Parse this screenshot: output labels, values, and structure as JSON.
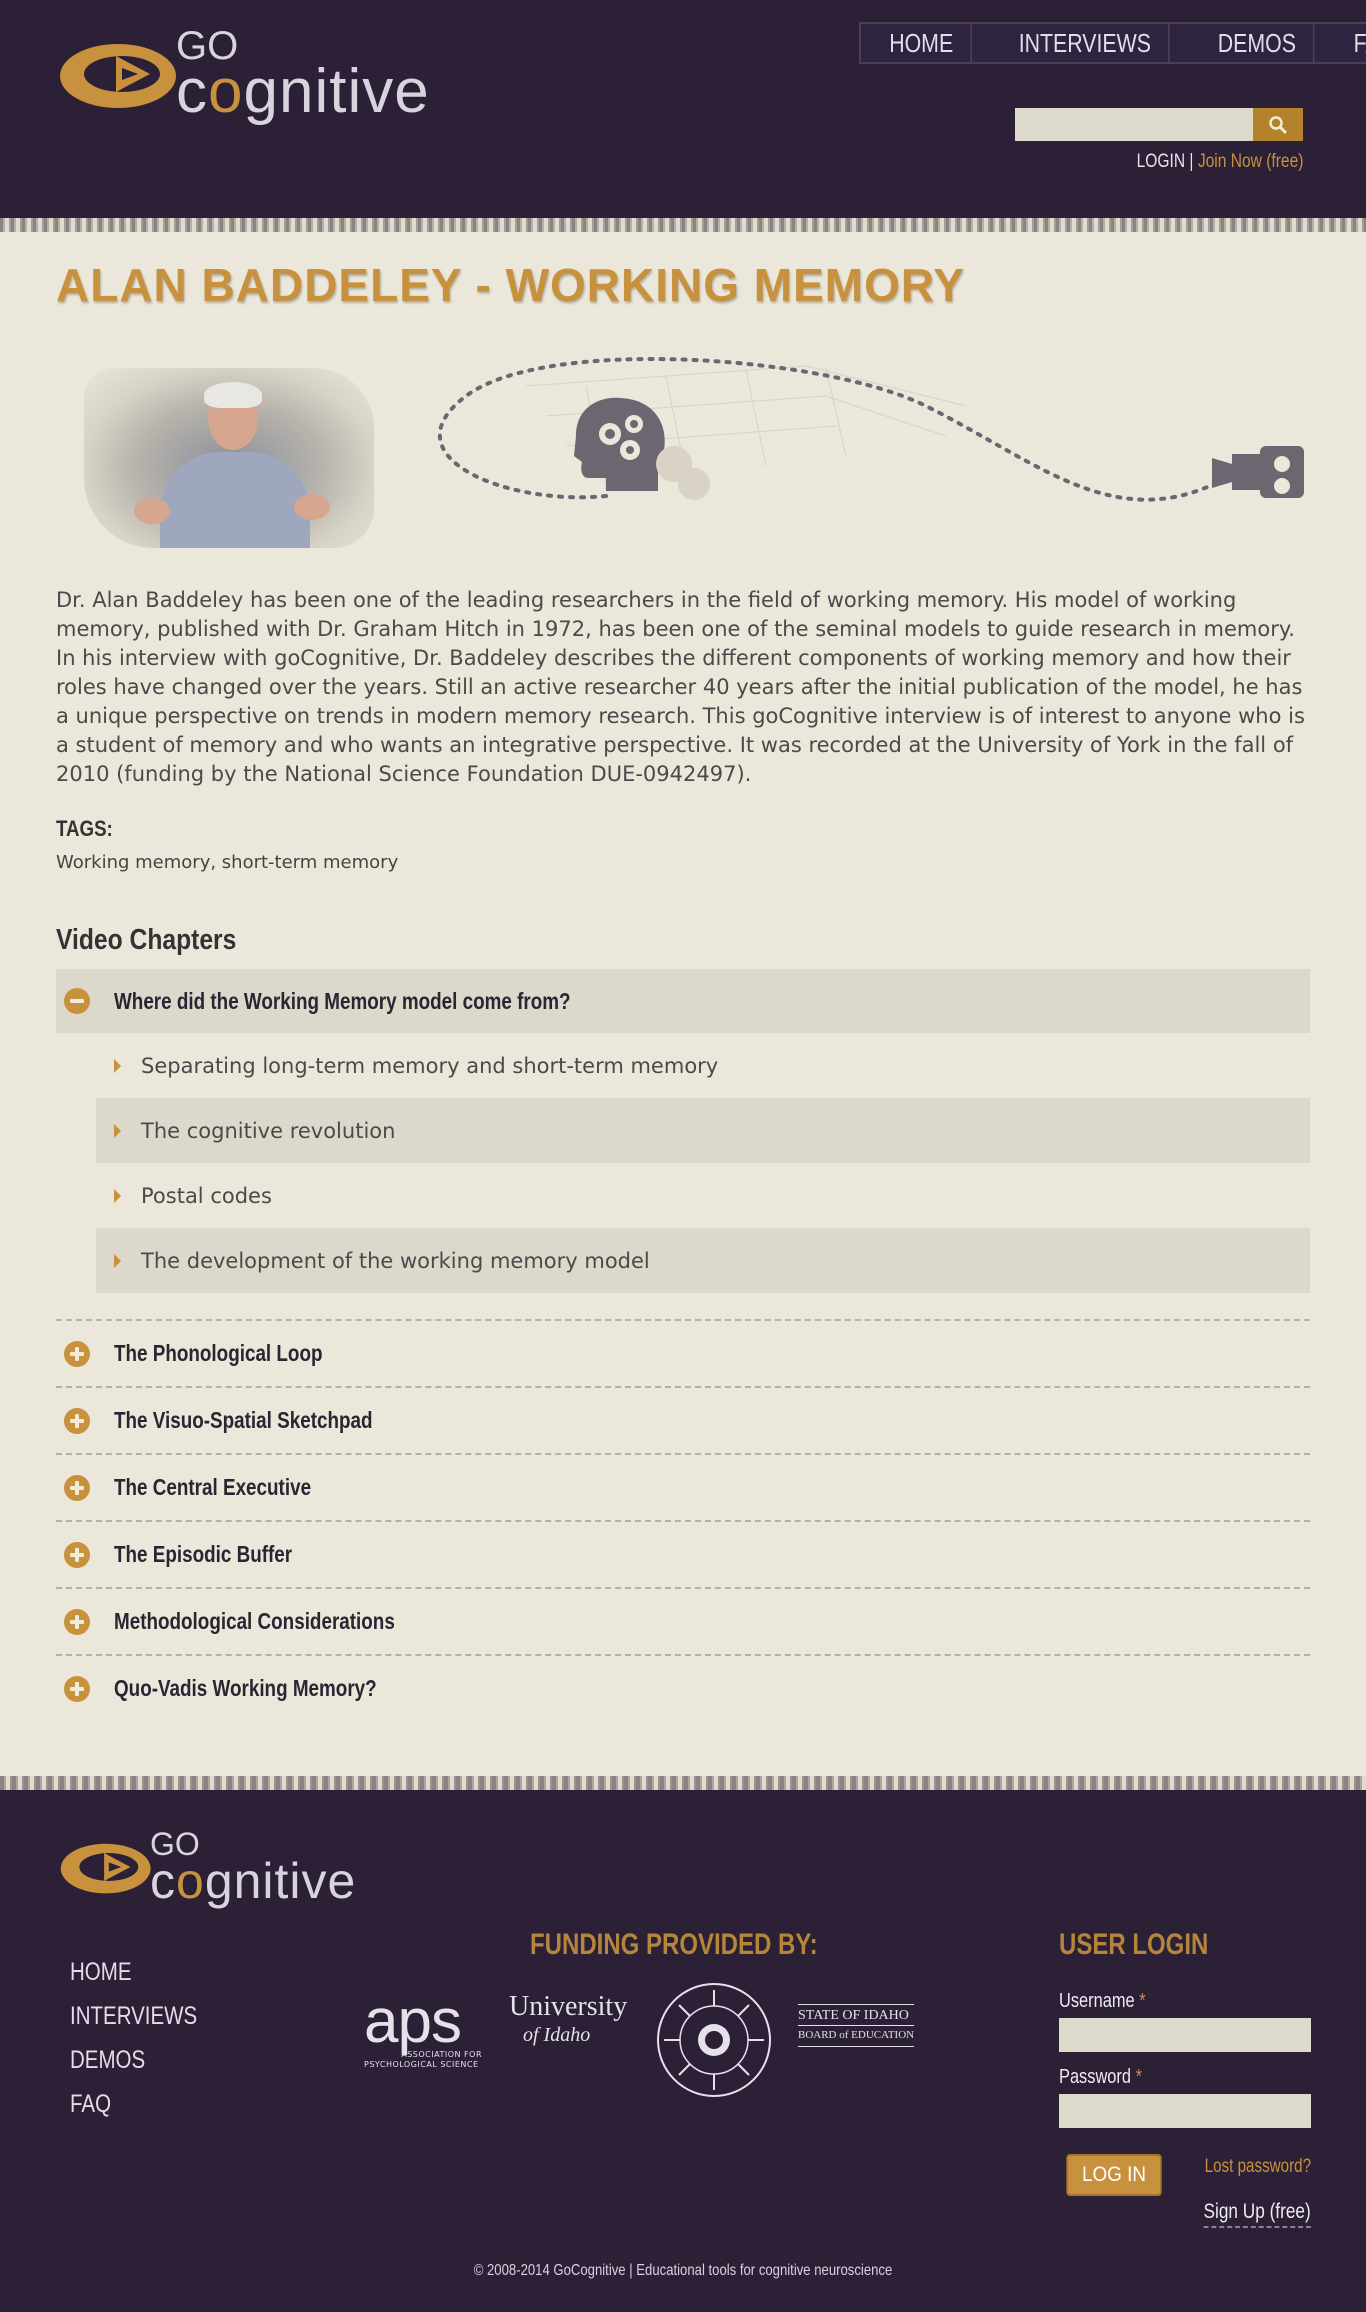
{
  "brand": {
    "logo_go": "GO",
    "logo_cog_a": "c",
    "logo_cog_o": "o",
    "logo_cog_b": "gnitive",
    "accent": "#c8913e",
    "background": "#2b2036"
  },
  "nav": {
    "items": [
      "HOME",
      "INTERVIEWS",
      "DEMOS",
      "FAQ"
    ]
  },
  "search": {
    "value": "",
    "icon": "search-icon"
  },
  "auth": {
    "login": "LOGIN",
    "separator": "|",
    "join": "Join Now (free)"
  },
  "page": {
    "title": "ALAN BADDELEY - WORKING MEMORY",
    "description": "Dr. Alan Baddeley has been one of the leading researchers in the field of working memory. His model of working memory, published with Dr. Graham Hitch in 1972, has been one of the seminal models to guide research in memory. In his interview with goCognitive, Dr. Baddeley describes the different components of working memory and how their roles have changed over the years. Still an active researcher 40 years after the initial publication of the model, he has a unique perspective on trends in modern memory research. This goCognitive interview is of interest to anyone who is a student of memory and who wants an integrative perspective. It was recorded at the University of York in the fall of 2010 (funding by the National Science Foundation DUE-0942497).",
    "tags_heading": "TAGS:",
    "tags": "Working memory, short-term memory"
  },
  "chapters": {
    "heading": "Video Chapters",
    "open": {
      "title": "Where did the Working Memory model come from?",
      "items": [
        "Separating long-term memory and short-term memory",
        "The cognitive revolution",
        "Postal codes",
        "The development of the working memory model"
      ]
    },
    "closed": [
      "The Phonological Loop",
      "The Visuo-Spatial Sketchpad",
      "The Central Executive",
      "The Episodic Buffer",
      "Methodological Considerations",
      "Quo-Vadis Working Memory?"
    ]
  },
  "footer": {
    "nav": [
      "HOME",
      "INTERVIEWS",
      "DEMOS",
      "FAQ"
    ],
    "funding_heading": "FUNDING PROVIDED BY:",
    "funders": {
      "aps_big": "aps",
      "aps_small_1": "ASSOCIATION FOR",
      "aps_small_2": "PSYCHOLOGICAL SCIENCE",
      "uidaho_1": "University",
      "uidaho_2": "of Idaho",
      "nsf": "NATIONAL SCIENCE FOUNDATION",
      "sboe_1": "STATE OF IDAHO",
      "sboe_2": "BOARD of EDUCATION"
    },
    "login": {
      "heading": "USER LOGIN",
      "username_label": "Username",
      "password_label": "Password",
      "required": "*",
      "button": "LOG IN",
      "lost_password": "Lost password?",
      "signup": "Sign Up (free)"
    },
    "copyright": "© 2008-2014 GoCognitive | Educational tools for cognitive neuroscience"
  }
}
